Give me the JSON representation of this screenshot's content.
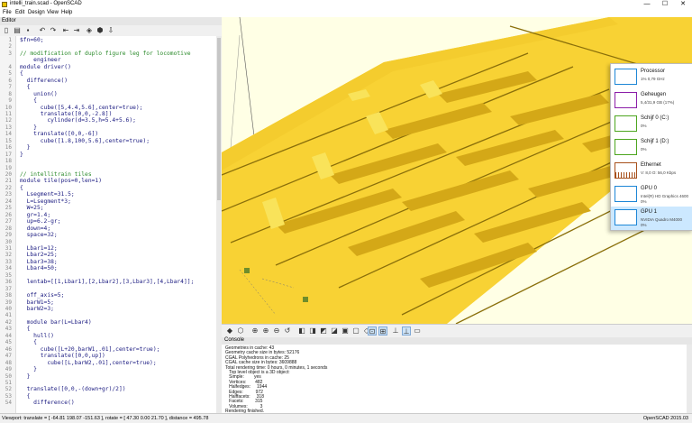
{
  "window": {
    "title": "intelli_train.scad - OpenSCAD",
    "minimize": "—",
    "maximize": "☐",
    "close": "✕"
  },
  "menu": [
    "File",
    "Edit",
    "Design",
    "View",
    "Help"
  ],
  "editor": {
    "title": "Editor",
    "lines": [
      {
        "n": "1",
        "code": "$fn=60;"
      },
      {
        "n": "2",
        "code": ""
      },
      {
        "n": "3",
        "code": "// modification of duplo figure leg for locomotive"
      },
      {
        "n": "",
        "code": "    engineer"
      },
      {
        "n": "4",
        "code": "module driver()"
      },
      {
        "n": "5",
        "code": "{"
      },
      {
        "n": "6",
        "code": "  difference()"
      },
      {
        "n": "7",
        "code": "  {"
      },
      {
        "n": "8",
        "code": "    union()"
      },
      {
        "n": "9",
        "code": "    {"
      },
      {
        "n": "10",
        "code": "      cube([5,4.4,5.6],center=true);"
      },
      {
        "n": "11",
        "code": "      translate([0,0,-2.8])"
      },
      {
        "n": "12",
        "code": "        cylinder(d=3.5,h=5.4+5.6);"
      },
      {
        "n": "13",
        "code": "    }"
      },
      {
        "n": "14",
        "code": "    translate([0,0,-6])"
      },
      {
        "n": "15",
        "code": "      cube([1.8,100,5.6],center=true);"
      },
      {
        "n": "16",
        "code": "  }"
      },
      {
        "n": "17",
        "code": "}"
      },
      {
        "n": "18",
        "code": ""
      },
      {
        "n": "19",
        "code": ""
      },
      {
        "n": "20",
        "code": "// intellitrain tiles"
      },
      {
        "n": "21",
        "code": "module tile(pos=0,len=1)"
      },
      {
        "n": "22",
        "code": "{"
      },
      {
        "n": "23",
        "code": "  Lsegment=31.5;"
      },
      {
        "n": "24",
        "code": "  L=Lsegment*3;"
      },
      {
        "n": "25",
        "code": "  W=25;"
      },
      {
        "n": "26",
        "code": "  gr=1.4;"
      },
      {
        "n": "27",
        "code": "  up=6.2-gr;"
      },
      {
        "n": "28",
        "code": "  down=4;"
      },
      {
        "n": "29",
        "code": "  space=32;"
      },
      {
        "n": "30",
        "code": ""
      },
      {
        "n": "31",
        "code": "  Lbar1=12;"
      },
      {
        "n": "32",
        "code": "  Lbar2=25;"
      },
      {
        "n": "33",
        "code": "  Lbar3=38;"
      },
      {
        "n": "34",
        "code": "  Lbar4=50;"
      },
      {
        "n": "35",
        "code": ""
      },
      {
        "n": "36",
        "code": "  lentab=[[1,Lbar1],[2,Lbar2],[3,Lbar3],[4,Lbar4]];"
      },
      {
        "n": "37",
        "code": ""
      },
      {
        "n": "38",
        "code": "  off_axis=5;"
      },
      {
        "n": "39",
        "code": "  barW1=5;"
      },
      {
        "n": "40",
        "code": "  barW2=3;"
      },
      {
        "n": "41",
        "code": ""
      },
      {
        "n": "42",
        "code": "  module bar(L=Lbar4)"
      },
      {
        "n": "43",
        "code": "  {"
      },
      {
        "n": "44",
        "code": "    hull()"
      },
      {
        "n": "45",
        "code": "    {"
      },
      {
        "n": "46",
        "code": "      cube([L+20,barW1,.01],center=true);"
      },
      {
        "n": "47",
        "code": "      translate([0,0,up])"
      },
      {
        "n": "48",
        "code": "        cube([L,barW2,.01],center=true);"
      },
      {
        "n": "49",
        "code": "    }"
      },
      {
        "n": "50",
        "code": "  }"
      },
      {
        "n": "51",
        "code": ""
      },
      {
        "n": "52",
        "code": "  translate([0,0,-(down+gr)/2])"
      },
      {
        "n": "53",
        "code": "  {"
      },
      {
        "n": "54",
        "code": "    difference()"
      }
    ]
  },
  "console": {
    "title": "Console",
    "lines": [
      "Geometries in cache: 43",
      "Geometry cache size in bytes: 52176",
      "CGAL Polyhedrons in cache: 25",
      "CGAL cache size in bytes: 3609888",
      "Total rendering time: 0 hours, 0 minutes, 1 seconds",
      "   Top level object is a 3D object:",
      "   Simple:        yes",
      "   Vertices:       482",
      "   Halfedges:     1944",
      "   Edges:          972",
      "   Halffacets:     318",
      "   Facets:         315",
      "   Volumes:          3",
      "Rendering finished."
    ]
  },
  "status": {
    "left": "Viewport: translate = [ -64.81 198.07 -151.63 ], rotate = [ 47.30 0.00 21.70 ], distance = 495.78",
    "right": "OpenSCAD 2015.03"
  },
  "task_manager": [
    {
      "name": "Processor",
      "l1": "1% 0,79 GHz",
      "l2": "",
      "color": "#1d86d6",
      "selected": false
    },
    {
      "name": "Geheugen",
      "l1": "5,4/31,9 GB (17%)",
      "l2": "",
      "color": "#8b1ea8",
      "selected": false
    },
    {
      "name": "Schijf 0 (C:)",
      "l1": "0%",
      "l2": "",
      "color": "#4ca51e",
      "selected": false
    },
    {
      "name": "Schijf 1 (D:)",
      "l1": "0%",
      "l2": "",
      "color": "#4ca51e",
      "selected": false
    },
    {
      "name": "Ethernet",
      "l1": "V: 8,0  O: 56,0 Kbps",
      "l2": "",
      "color": "#a7501b",
      "selected": false
    },
    {
      "name": "GPU 0",
      "l1": "Intel(R) HD Graphics 4600",
      "l2": "0%",
      "color": "#1d86d6",
      "selected": false
    },
    {
      "name": "GPU 1",
      "l1": "NVIDIA Quadro M4000",
      "l2": "0%",
      "color": "#1d86d6",
      "selected": true
    }
  ],
  "colors": {
    "model_yellow": "#f8d234",
    "model_top": "#f4cc2e",
    "groove": "#8a6f0a",
    "background": "#ffffe5"
  }
}
